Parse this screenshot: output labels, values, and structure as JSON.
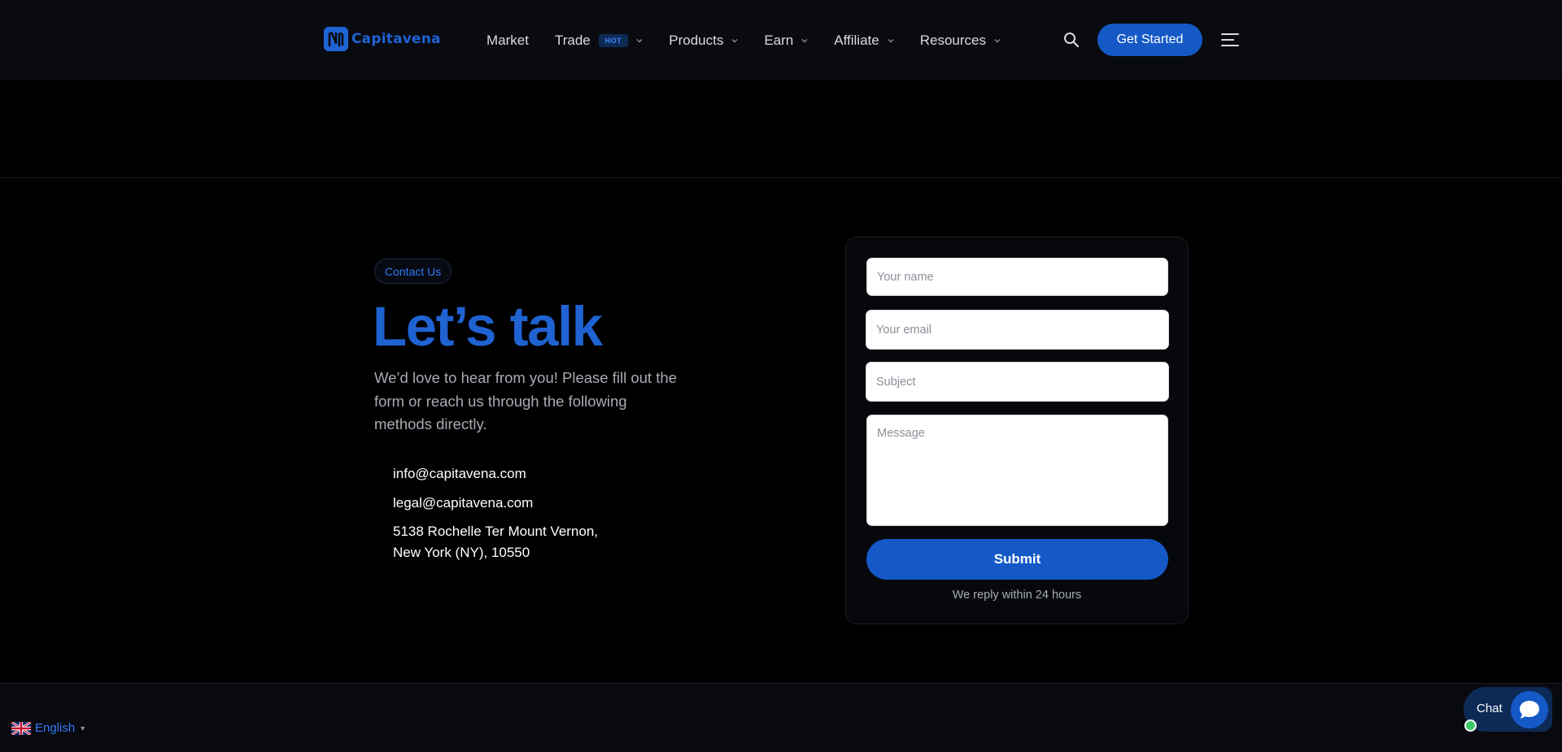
{
  "header": {
    "brand": "Capitavena",
    "nav": [
      {
        "label": "Market",
        "has_dropdown": false
      },
      {
        "label": "Trade",
        "badge": "HOT",
        "has_dropdown": true
      },
      {
        "label": "Products",
        "has_dropdown": true
      },
      {
        "label": "Earn",
        "has_dropdown": true
      },
      {
        "label": "Affiliate",
        "has_dropdown": true
      },
      {
        "label": "Resources",
        "has_dropdown": true
      }
    ],
    "search_icon": "search-icon",
    "cta_label": "Get Started",
    "menu_icon": "hamburger-menu-icon"
  },
  "contact": {
    "tag": "Contact Us",
    "heading": "Let’s talk",
    "lead": "We’d love to hear from you! Please fill out the form or reach us through the following methods directly.",
    "email_primary": "info@capitavena.com",
    "email_legal": "legal@capitavena.com",
    "address_line1": "5138 Rochelle Ter Mount Vernon,",
    "address_line2": "New York (NY), 10550"
  },
  "form": {
    "name_placeholder": "Your name",
    "email_placeholder": "Your email",
    "subject_placeholder": "Subject",
    "message_placeholder": "Message",
    "submit_label": "Submit",
    "reply_note": "We reply within 24 hours"
  },
  "footer": {
    "language": "English"
  },
  "chat": {
    "label": "Chat"
  },
  "colors": {
    "accent": "#1559c7",
    "heading": "#1f62d2",
    "background": "#000000"
  }
}
